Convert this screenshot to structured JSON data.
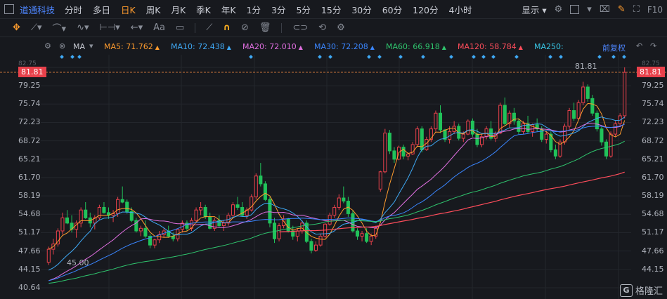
{
  "header": {
    "title": "道通科技",
    "tabs": [
      {
        "label": "分时",
        "active": false
      },
      {
        "label": "多日",
        "active": false
      },
      {
        "label": "日K",
        "active": true
      },
      {
        "label": "周K",
        "active": false
      },
      {
        "label": "月K",
        "active": false
      },
      {
        "label": "季K",
        "active": false
      },
      {
        "label": "年K",
        "active": false
      },
      {
        "label": "1分",
        "active": false
      },
      {
        "label": "3分",
        "active": false
      },
      {
        "label": "5分",
        "active": false
      },
      {
        "label": "15分",
        "active": false
      },
      {
        "label": "30分",
        "active": false
      },
      {
        "label": "60分",
        "active": false
      },
      {
        "label": "120分",
        "active": false
      },
      {
        "label": "4小时",
        "active": false
      }
    ],
    "display_label": "显示",
    "f10_label": "F10"
  },
  "toolbar": {
    "icons": [
      "move-icon",
      "line-icon",
      "polyline-icon",
      "wave-icon",
      "range-icon",
      "arrow-icon",
      "text-icon",
      "note-icon",
      "ruler-icon",
      "magnet-icon",
      "hide-icon",
      "delete-icon",
      "link-icon",
      "sync-icon",
      "settings-icon"
    ],
    "text_tool_label": "Aa"
  },
  "ma_bar": {
    "indicator": "MA",
    "ma5": "MA5: 71.762",
    "ma10": "MA10: 72.438",
    "ma20": "MA20: 72.010",
    "ma30": "MA30: 72.208",
    "ma60": "MA60: 66.918",
    "ma120": "MA120: 58.784",
    "ma250": "MA250:",
    "adjust_label": "前复权",
    "colors": {
      "ma5": "#ff9c2e",
      "ma10": "#3fa9f5",
      "ma20": "#e06fe0",
      "ma30": "#3a86ff",
      "ma60": "#2fc46d",
      "ma120": "#ff4d5b",
      "ma250": "#38c8e8"
    }
  },
  "chart_data": {
    "type": "candlestick",
    "y_ticks": [
      "82.75",
      "81.81",
      "79.25",
      "75.74",
      "72.23",
      "68.72",
      "65.21",
      "61.70",
      "58.19",
      "54.68",
      "51.17",
      "47.66",
      "44.15",
      "40.64"
    ],
    "right_ticks": [
      "81.81",
      "79.25",
      "75.74",
      "72.23",
      "68.72",
      "65.21",
      "61.70",
      "58.19",
      "54.68",
      "51.17",
      "47.66",
      "44.15"
    ],
    "last_price": "81.81",
    "high_label": "81.81",
    "low_label": "45.00",
    "ylim": [
      40.64,
      82.75
    ],
    "up_color": "#e8414b",
    "down_color": "#21c25a",
    "ohlc": [
      [
        45.5,
        48.5,
        45,
        48
      ],
      [
        48,
        50,
        47,
        49
      ],
      [
        49,
        52,
        48.5,
        51.5
      ],
      [
        51.5,
        55,
        50.8,
        54
      ],
      [
        54,
        55.5,
        52.8,
        53
      ],
      [
        53,
        54.5,
        51.2,
        51.8
      ],
      [
        51.8,
        53.5,
        50.2,
        53
      ],
      [
        53,
        56,
        52.2,
        55.5
      ],
      [
        55.5,
        57,
        53.8,
        54
      ],
      [
        54,
        55,
        52.2,
        53
      ],
      [
        53,
        54.5,
        51.8,
        54
      ],
      [
        54,
        56.5,
        53.5,
        56
      ],
      [
        56,
        57,
        54.8,
        55
      ],
      [
        55,
        56,
        53.8,
        54.5
      ],
      [
        54.5,
        55.5,
        53.2,
        54.8
      ],
      [
        54.8,
        58,
        54.2,
        57.5
      ],
      [
        57.5,
        60,
        56.8,
        57
      ],
      [
        57,
        57.5,
        54.8,
        55.2
      ],
      [
        55.2,
        56,
        53.2,
        53.5
      ],
      [
        53.5,
        54,
        51.2,
        51.5
      ],
      [
        51.5,
        52.5,
        50.5,
        52
      ],
      [
        52,
        53.5,
        50.2,
        50.5
      ],
      [
        50.5,
        51,
        48.2,
        48.8
      ],
      [
        48.8,
        50,
        48.2,
        49.8
      ],
      [
        49.8,
        51.5,
        49.2,
        50.8
      ],
      [
        50.8,
        52,
        50.2,
        51.5
      ],
      [
        51.5,
        52.5,
        50.2,
        50.5
      ],
      [
        50.5,
        51.2,
        49.5,
        50
      ],
      [
        50,
        52,
        49.5,
        51.8
      ],
      [
        51.8,
        53.5,
        51.2,
        53
      ],
      [
        53,
        53.5,
        51.5,
        52
      ],
      [
        52,
        54,
        51.5,
        53.5
      ],
      [
        53.5,
        56,
        53.2,
        55.5
      ],
      [
        55.5,
        57,
        54.5,
        56
      ],
      [
        56,
        56.5,
        53.8,
        54.2
      ],
      [
        54.2,
        55,
        51.8,
        52
      ],
      [
        52,
        54,
        51.5,
        53.5
      ],
      [
        53.5,
        54.5,
        52.2,
        52.5
      ],
      [
        52.5,
        53.5,
        51.5,
        53
      ],
      [
        53,
        55,
        52.5,
        54.5
      ],
      [
        54.5,
        57,
        54.2,
        56.5
      ],
      [
        56.5,
        58,
        55.5,
        56
      ],
      [
        56,
        57,
        54.2,
        54.5
      ],
      [
        54.5,
        56,
        53.8,
        55.5
      ],
      [
        55.5,
        58.5,
        55.2,
        58
      ],
      [
        58,
        62.5,
        57.5,
        62
      ],
      [
        62,
        64.5,
        60,
        60.5
      ],
      [
        60.5,
        61,
        57.2,
        57.5
      ],
      [
        57.5,
        58,
        52.2,
        53
      ],
      [
        53,
        54,
        49.2,
        50
      ],
      [
        50,
        53,
        49.5,
        52.5
      ],
      [
        52.5,
        54.5,
        52,
        53.8
      ],
      [
        53.8,
        54,
        51.2,
        51.5
      ],
      [
        51.5,
        52.5,
        49.8,
        50.5
      ],
      [
        50.5,
        52,
        49.5,
        51.5
      ],
      [
        51.5,
        53.5,
        51,
        53
      ],
      [
        53,
        53.5,
        49.2,
        49.5
      ],
      [
        49.5,
        50,
        47.2,
        47.8
      ],
      [
        47.8,
        49.5,
        47.5,
        48.8
      ],
      [
        48.8,
        51,
        48.5,
        50.5
      ],
      [
        50.5,
        53,
        50.2,
        52.8
      ],
      [
        52.8,
        55,
        52.5,
        54.5
      ],
      [
        54.5,
        56.5,
        54,
        56
      ],
      [
        56,
        58.5,
        55.5,
        57.8
      ],
      [
        57.8,
        60,
        56.8,
        57.2
      ],
      [
        57.2,
        58,
        54.2,
        54.8
      ],
      [
        54.8,
        55.5,
        51.2,
        51.5
      ],
      [
        51.5,
        52,
        49.8,
        50.5
      ],
      [
        50.5,
        51.5,
        49.5,
        51
      ],
      [
        51,
        52,
        49.2,
        49.5
      ],
      [
        49.5,
        51,
        48.8,
        50.5
      ],
      [
        50.5,
        52.5,
        50,
        52
      ],
      [
        59.5,
        63,
        59,
        62.8
      ],
      [
        62.8,
        71,
        62.5,
        70.2
      ],
      [
        70.2,
        70.8,
        66.2,
        66.8
      ],
      [
        66.8,
        67.5,
        64.5,
        65.2
      ],
      [
        65.2,
        67.8,
        65,
        67.5
      ],
      [
        67.5,
        68,
        65.2,
        65.8
      ],
      [
        65.8,
        66.5,
        65,
        66.2
      ],
      [
        66.2,
        68.5,
        66,
        68
      ],
      [
        68,
        71.5,
        67.5,
        71
      ],
      [
        71,
        71.5,
        66.5,
        67
      ],
      [
        67,
        69.5,
        66.8,
        69
      ],
      [
        69,
        71.5,
        68.5,
        71
      ],
      [
        71,
        74.5,
        70.5,
        74
      ],
      [
        74,
        75.5,
        70.2,
        70.8
      ],
      [
        70.8,
        71,
        68.5,
        69
      ],
      [
        69,
        71.5,
        68.2,
        70.5
      ],
      [
        70.5,
        72.5,
        70,
        71.5
      ],
      [
        71.5,
        72,
        68.8,
        69.2
      ],
      [
        69.2,
        70.5,
        68.5,
        70
      ],
      [
        70,
        72.8,
        69.8,
        72.5
      ],
      [
        72.5,
        73,
        69.5,
        70
      ],
      [
        70,
        71,
        67.5,
        68
      ],
      [
        68,
        70,
        67.5,
        69.5
      ],
      [
        69.5,
        71.5,
        69,
        71
      ],
      [
        71,
        72.5,
        68.8,
        69.2
      ],
      [
        69.2,
        70.5,
        68.5,
        70.2
      ],
      [
        70.2,
        76,
        70,
        75.5
      ],
      [
        75.5,
        77,
        71.5,
        72
      ],
      [
        72,
        74.5,
        71.2,
        74
      ],
      [
        74,
        75,
        71.8,
        72.5
      ],
      [
        72.5,
        73,
        70,
        70.5
      ],
      [
        70.5,
        72.5,
        70,
        72
      ],
      [
        72,
        73.5,
        70.2,
        70.5
      ],
      [
        70.5,
        72,
        69.5,
        71.8
      ],
      [
        71.8,
        73,
        70.5,
        71
      ],
      [
        71,
        71.5,
        68.5,
        69
      ],
      [
        69,
        70.5,
        68.2,
        70
      ],
      [
        70,
        70.5,
        66.5,
        67
      ],
      [
        67,
        68,
        65.2,
        65.8
      ],
      [
        65.8,
        69,
        65.5,
        68.5
      ],
      [
        68.5,
        72,
        68,
        71.5
      ],
      [
        71.5,
        75,
        71,
        74.5
      ],
      [
        74.5,
        76,
        72.5,
        73
      ],
      [
        73,
        76.5,
        72.8,
        76
      ],
      [
        76,
        80,
        75.5,
        79
      ],
      [
        79,
        79.5,
        76.2,
        76.8
      ],
      [
        76.8,
        77.5,
        73.5,
        74
      ],
      [
        74,
        74.5,
        70.5,
        71
      ],
      [
        71,
        71.5,
        67.8,
        68.5
      ],
      [
        68.5,
        69,
        65.2,
        65.8
      ],
      [
        65.8,
        70.5,
        65.5,
        70
      ],
      [
        70,
        72.5,
        69.5,
        72
      ],
      [
        72,
        74,
        71.5,
        73.5
      ],
      [
        73.5,
        82.75,
        73,
        81.8
      ]
    ]
  }
}
